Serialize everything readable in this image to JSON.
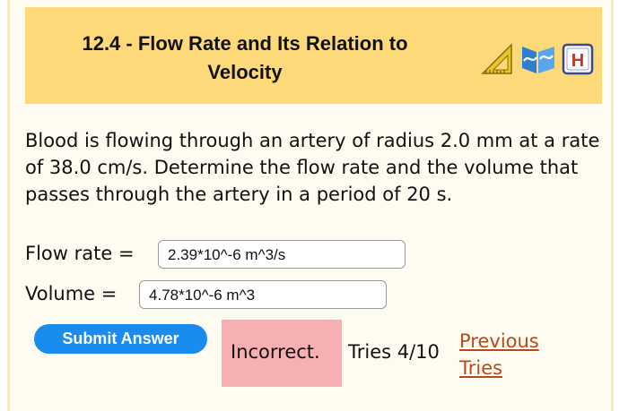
{
  "header": {
    "title_line1": "12.4 - Flow Rate and Its Relation to",
    "title_line2": "Velocity",
    "icons": [
      "ruler-triangle-icon",
      "book-wave-icon",
      "hint-h-icon"
    ]
  },
  "problem": {
    "text": "Blood is flowing through an artery of radius 2.0 mm at a rate of 38.0 cm/s. Determine the flow rate and the volume that passes through the artery in a period of 20 s."
  },
  "answers": {
    "flow_rate": {
      "label": "Flow rate =",
      "value": "2.39*10^-6 m^3/s"
    },
    "volume": {
      "label": "Volume =",
      "value": "4.78*10^-6 m^3"
    }
  },
  "actions": {
    "submit_label": "Submit Answer",
    "status": "Incorrect.",
    "tries": "Tries 4/10",
    "previous_tries_line1": "Previous",
    "previous_tries_line2": "Tries"
  },
  "colors": {
    "header_bg": "#fdd97a",
    "submit_bg": "#1a8cf0",
    "incorrect_bg": "#f6b0b3",
    "link": "#b8491a"
  }
}
